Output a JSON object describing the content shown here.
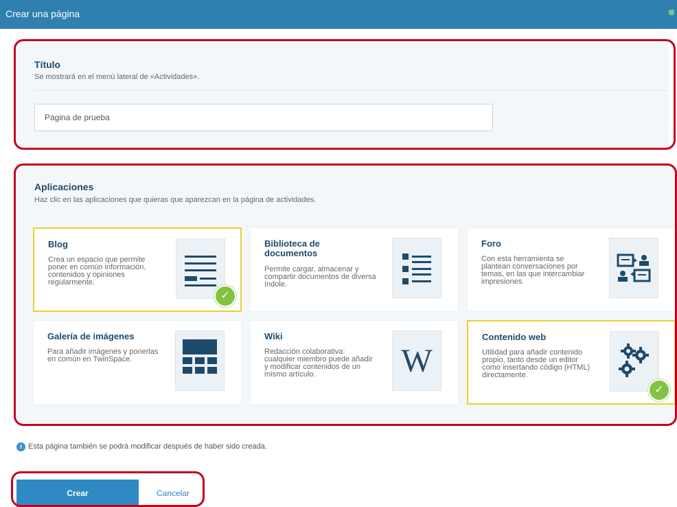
{
  "window": {
    "title": "Crear una página"
  },
  "title_section": {
    "heading": "Título",
    "subtitle": "Se mostrará en el menú lateral de «Actividades».",
    "input_value": "Página de prueba"
  },
  "apps_section": {
    "heading": "Aplicaciones",
    "subtitle": "Haz clic en las aplicaciones que quieras que aparezcan en la página de actividades."
  },
  "apps": [
    {
      "name": "Blog",
      "desc": "Crea un espacio que permite poner en común información, contenidos y opiniones regularmente.",
      "icon": "blog-icon",
      "selected": true
    },
    {
      "name": "Biblioteca de documentos",
      "desc": "Permite cargar, almacenar y compartir documentos de diversa índole.",
      "icon": "document-library-icon",
      "selected": false
    },
    {
      "name": "Foro",
      "desc": "Con esta herramienta se plantean conversaciones por temas, en las que intercambiar impresiones.",
      "icon": "forum-icon",
      "selected": false
    },
    {
      "name": "Galería de imágenes",
      "desc": "Para añadir imágenes y ponerlas en común en TwinSpace.",
      "icon": "gallery-icon",
      "selected": false
    },
    {
      "name": "Wiki",
      "desc": "Redacción colaborativa: cualquier miembro puede añadir y modificar contenidos de un mismo artículo.",
      "icon": "wiki-icon",
      "selected": false,
      "icon_letter": "W"
    },
    {
      "name": "Contenido web",
      "desc": "Utilidad para añadir contenido propio, tanto desde un editor como insertando código (HTML) directamente.",
      "icon": "gears-icon",
      "selected": true
    }
  ],
  "info_note": "Esta página también se podrá modificar después de haber sido creada.",
  "buttons": {
    "create": "Crear",
    "cancel": "Cancelar"
  },
  "colors": {
    "accent": "#2f8ac4",
    "highlight": "#c4001c",
    "selected": "#e8d035",
    "check": "#82c341"
  }
}
